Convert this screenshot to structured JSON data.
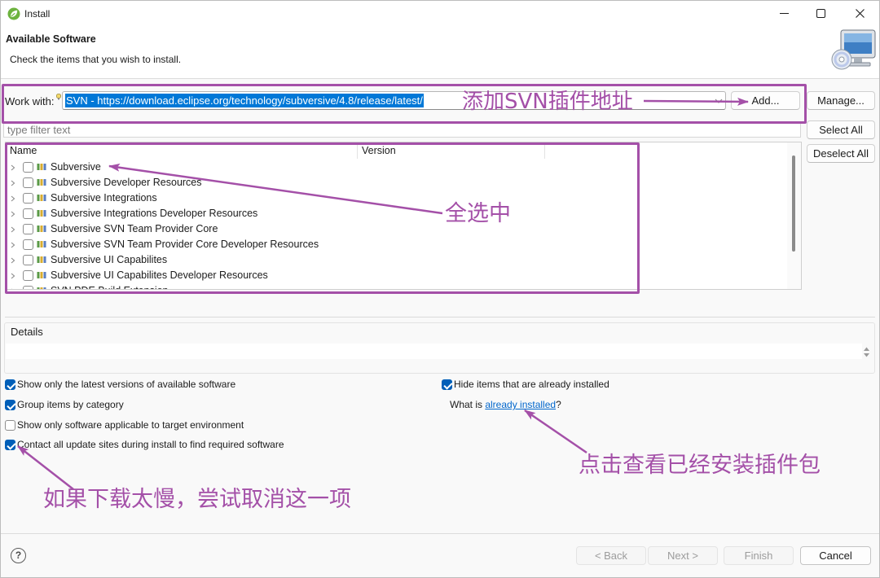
{
  "window": {
    "title": "Install",
    "icons": {
      "app": "eclipse-spring-icon",
      "minimize": "minimize-icon",
      "maximize": "maximize-icon",
      "close": "close-icon"
    }
  },
  "header": {
    "title": "Available Software",
    "subtitle": "Check the items that you wish to install.",
    "icon": "computer-cd-icon"
  },
  "work_with": {
    "label": "Work with:",
    "value": "SVN - https://download.eclipse.org/technology/subversive/4.8/release/latest/",
    "add_label": "Add...",
    "manage_label": "Manage..."
  },
  "filter": {
    "placeholder": "type filter text"
  },
  "buttons": {
    "select_all": "Select All",
    "deselect_all": "Deselect All"
  },
  "tree": {
    "columns": {
      "name": "Name",
      "version": "Version"
    },
    "items": [
      {
        "name": "Subversive",
        "checked": false
      },
      {
        "name": "Subversive Developer Resources",
        "checked": false
      },
      {
        "name": "Subversive Integrations",
        "checked": false
      },
      {
        "name": "Subversive Integrations Developer Resources",
        "checked": false
      },
      {
        "name": "Subversive SVN Team Provider Core",
        "checked": false
      },
      {
        "name": "Subversive SVN Team Provider Core Developer Resources",
        "checked": false
      },
      {
        "name": "Subversive UI Capabilites",
        "checked": false
      },
      {
        "name": "Subversive UI Capabilites Developer Resources",
        "checked": false
      },
      {
        "name": "SVN PDE Build Extension",
        "checked": false
      }
    ]
  },
  "details": {
    "label": "Details"
  },
  "options": {
    "latest_only": {
      "label": "Show only the latest versions of available software",
      "checked": true
    },
    "group_by_category": {
      "label": "Group items by category",
      "checked": true
    },
    "target_env_only": {
      "label": "Show only software applicable to target environment",
      "checked": false
    },
    "contact_all_sites": {
      "label": "Contact all update sites during install to find required software",
      "checked": true
    },
    "hide_installed": {
      "label": "Hide items that are already installed",
      "checked": true
    }
  },
  "installed_info": {
    "prefix": "What is ",
    "link_text": "already installed",
    "suffix": "?"
  },
  "annotations": {
    "add_site": "添加SVN插件地址",
    "select_all": "全选中",
    "view_installed": "点击查看已经安装插件包",
    "slow_download": "如果下载太慢，尝试取消这一项"
  },
  "footer": {
    "help_glyph": "?",
    "back": "< Back",
    "next": "Next >",
    "finish": "Finish",
    "cancel": "Cancel"
  },
  "colors": {
    "annotation": "#a450a8",
    "link": "#0066cc",
    "checkbox": "#005fb8",
    "selection": "#0078d7"
  }
}
